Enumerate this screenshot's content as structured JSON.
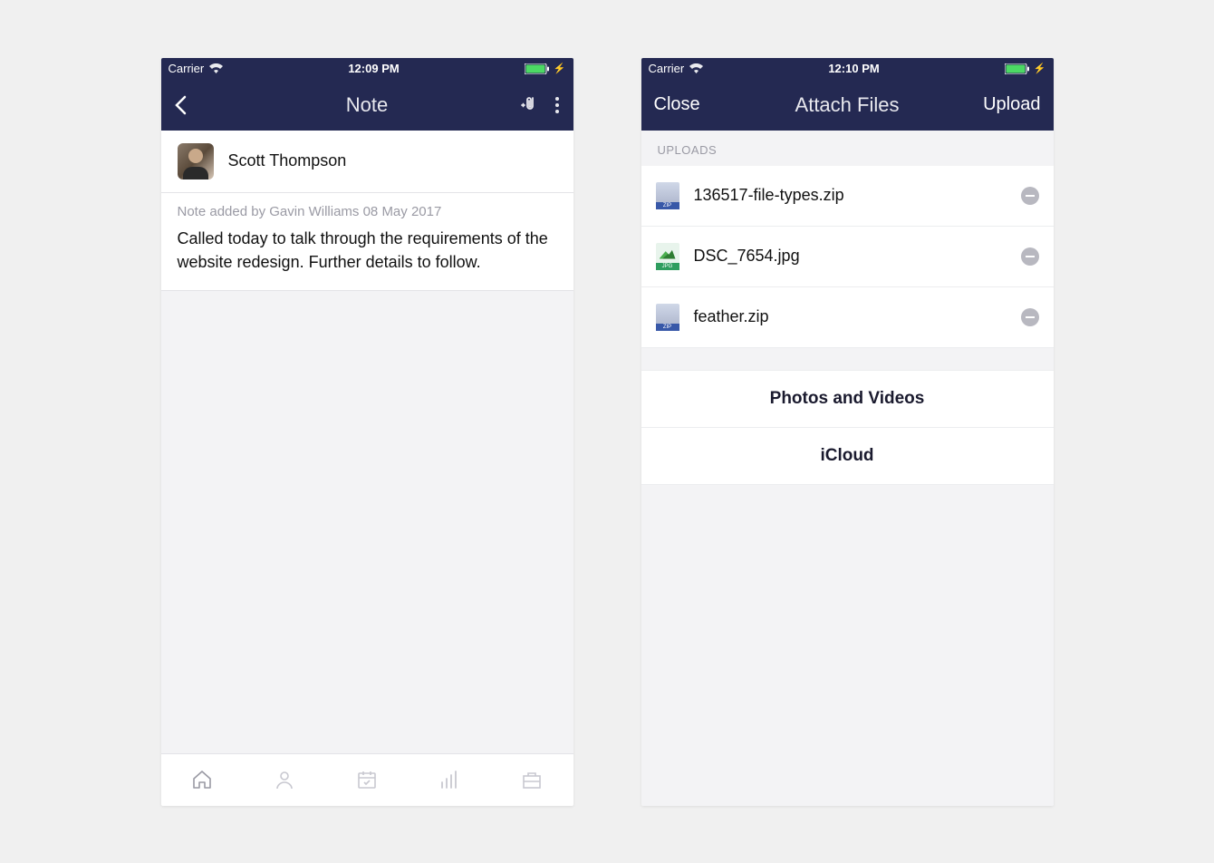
{
  "left": {
    "status": {
      "carrier": "Carrier",
      "time": "12:09 PM"
    },
    "nav": {
      "title": "Note"
    },
    "contact": {
      "name": "Scott Thompson"
    },
    "note": {
      "meta": "Note added by Gavin Williams 08 May 2017",
      "body": "Called today to talk through the requirements of the website redesign. Further details to follow."
    }
  },
  "right": {
    "status": {
      "carrier": "Carrier",
      "time": "12:10 PM"
    },
    "nav": {
      "close": "Close",
      "title": "Attach Files",
      "upload": "Upload"
    },
    "section_header": "UPLOADS",
    "files": [
      {
        "name": "136517-file-types.zip",
        "type": "zip"
      },
      {
        "name": "DSC_7654.jpg",
        "type": "jpg"
      },
      {
        "name": "feather.zip",
        "type": "zip"
      }
    ],
    "actions": {
      "photos": "Photos and Videos",
      "icloud": "iCloud"
    }
  }
}
